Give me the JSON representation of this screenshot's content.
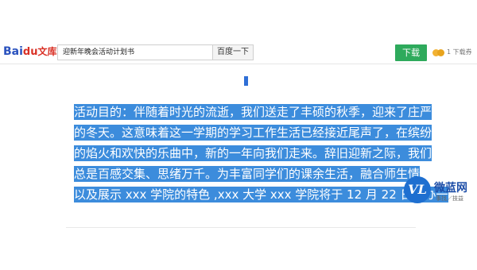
{
  "header": {
    "logo_text": "Bai",
    "logo_paw": "du",
    "logo_wenku": "文库",
    "search_value": "迎新年晚会活动计划书",
    "search_button": "百度一下",
    "download_button": "下载",
    "download_count": "1 下载券"
  },
  "document": {
    "lines": [
      "活动目的：伴随着时光的流逝，我们送走了丰硕的秋季，迎来了庄严",
      "的冬天。这意味着这一学期的学习工作生活已经接近尾声了，在缤纷",
      "的焰火和欢快的乐曲中，新的一年向我们走来。辞旧迎新之际，我们",
      "总是百感交集、思绪万千。为丰富同学们的课余生活，融合师生情",
      "以及展示 xxx 学院的特色 ,xxx 大学 xxx 学院将于 12 月 22 日举办一"
    ]
  },
  "watermark": {
    "logo_letters": "VL",
    "title": "微蓝网",
    "subtitle": "事找／技益"
  },
  "colors": {
    "highlight": "#3c8cdc",
    "download_green": "#2eaa5c"
  }
}
